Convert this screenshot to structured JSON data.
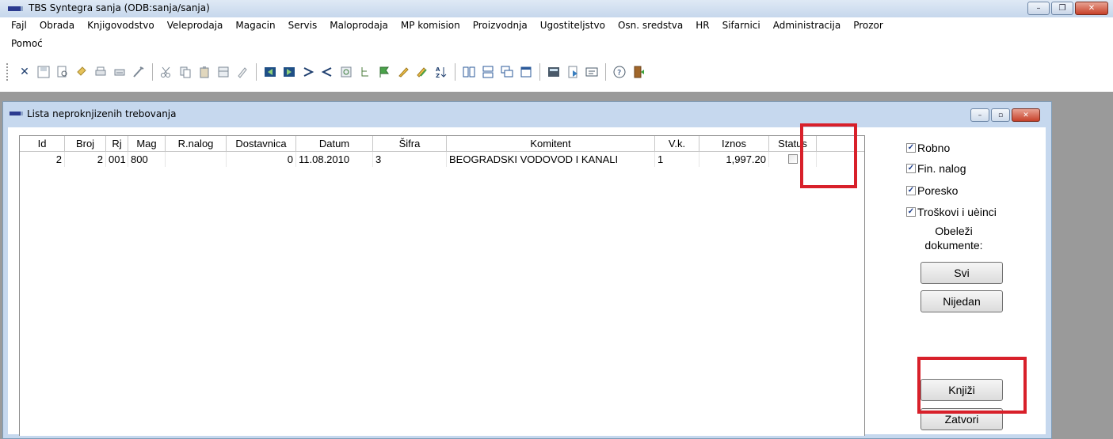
{
  "window": {
    "title": "TBS Syntegra sanja   (ODB:sanja/sanja)",
    "min": "–",
    "max": "❐",
    "close": "✕"
  },
  "menu": {
    "row1": [
      "Fajl",
      "Obrada",
      "Knjigovodstvo",
      "Veleprodaja",
      "Magacin",
      "Servis",
      "Maloprodaja",
      "MP komision",
      "Proizvodnja",
      "Ugostiteljstvo",
      "Osn. sredstva",
      "HR",
      "Sifarnici",
      "Administracija",
      "Prozor"
    ],
    "row2": [
      "Pomoć"
    ]
  },
  "toolbar": {
    "close_glyph": "✕"
  },
  "child": {
    "title": "Lista neproknjizenih trebovanja",
    "min": "–",
    "restore": "▫",
    "close": "✕"
  },
  "grid": {
    "headers": [
      "Id",
      "Broj",
      "Rj",
      "Mag",
      "R.nalog",
      "Dostavnica",
      "Datum",
      "Šifra",
      "Komitent",
      "V.k.",
      "Iznos",
      "Status"
    ],
    "rows": [
      {
        "id": "2",
        "broj": "2",
        "rj": "001",
        "mag": "800",
        "rnalog": "",
        "dostavnica": "0",
        "datum": "11.08.2010",
        "sifra": "3",
        "komitent": "BEOGRADSKI VODOVOD I KANALI",
        "vk": "1",
        "iznos": "1,997.20",
        "status": false
      }
    ]
  },
  "options": {
    "robno": "Robno",
    "fin_nalog": "Fin. nalog",
    "poresko": "Poresko",
    "troskovi": "Troškovi i uèinci",
    "check_glyph": "✓"
  },
  "mark": {
    "line1": "Obeleži",
    "line2": "dokumente:"
  },
  "buttons": {
    "svi": "Svi",
    "nijedan": "Nijedan",
    "knjizi": "Knjiži",
    "zatvori": "Zatvori"
  },
  "colors": {
    "highlight": "#d8202a"
  }
}
